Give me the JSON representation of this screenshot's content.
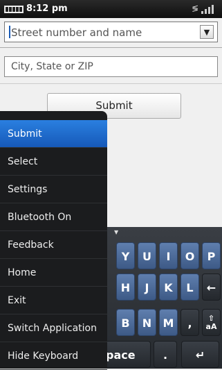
{
  "status": {
    "time": "8:12 pm",
    "bluetooth_glyph": "≶"
  },
  "form": {
    "street_placeholder": "Street number and name",
    "city_placeholder": "City, State or ZIP",
    "submit_label": "Submit",
    "dropdown_glyph": "▼"
  },
  "menu": {
    "items": [
      "Submit",
      "Select",
      "Settings",
      "Bluetooth On",
      "Feedback",
      "Home",
      "Exit",
      "Switch Application",
      "Hide Keyboard"
    ]
  },
  "keyboard": {
    "row1": [
      "Y",
      "U",
      "I",
      "O",
      "P"
    ],
    "row2": [
      "H",
      "J",
      "K",
      "L",
      "←"
    ],
    "row3": [
      "B",
      "N",
      "M",
      ","
    ],
    "shift_symbol": "⇧",
    "shift_label": "aA",
    "space_label": "pace",
    "period": ".",
    "enter": "↵",
    "collapse_glyph": "▼"
  }
}
